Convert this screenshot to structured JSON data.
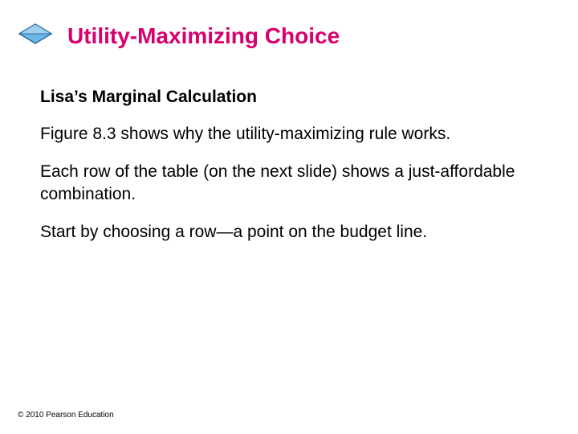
{
  "title": "Utility-Maximizing Choice",
  "subheading": "Lisa’s Marginal Calculation",
  "paragraphs": {
    "p1": "Figure 8.3 shows why the utility-maximizing rule works.",
    "p2": "Each row of the table (on the next slide) shows a just-affordable combination.",
    "p3": "Start by choosing a row—a point on the budget line."
  },
  "footer": "© 2010 Pearson Education",
  "colors": {
    "accent": "#d6006f",
    "bullet_fill": "#6fb7e6",
    "bullet_stroke": "#2a6aa3"
  }
}
